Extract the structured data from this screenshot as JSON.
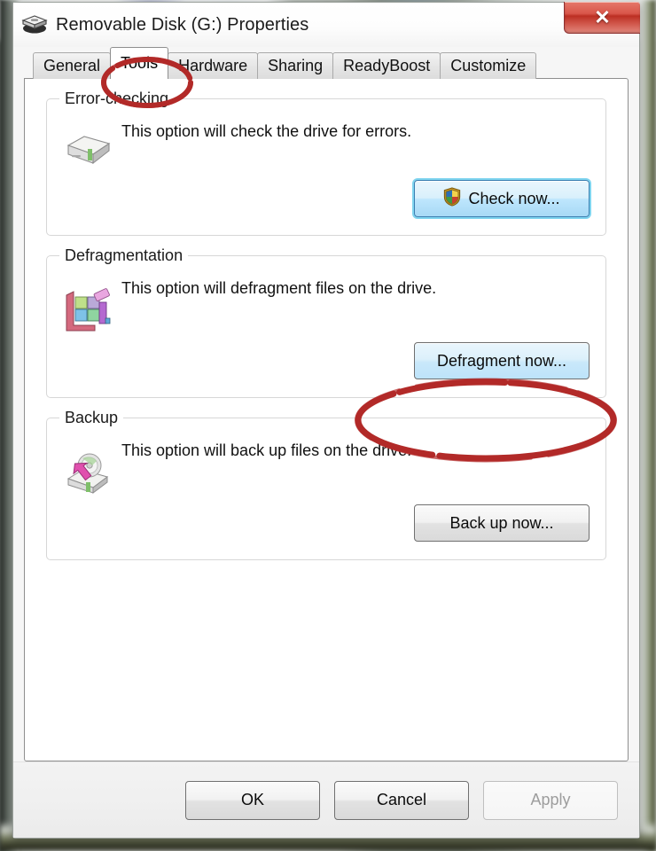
{
  "window": {
    "title": "Removable Disk (G:) Properties",
    "title_icon": "removable-disk-icon",
    "close_label": "✕"
  },
  "tabs": [
    {
      "id": "general",
      "label": "General",
      "active": false
    },
    {
      "id": "tools",
      "label": "Tools",
      "active": true
    },
    {
      "id": "hardware",
      "label": "Hardware",
      "active": false
    },
    {
      "id": "sharing",
      "label": "Sharing",
      "active": false
    },
    {
      "id": "readyboost",
      "label": "ReadyBoost",
      "active": false
    },
    {
      "id": "customize",
      "label": "Customize",
      "active": false
    }
  ],
  "groups": {
    "error_checking": {
      "title": "Error-checking",
      "icon": "hard-drive-icon",
      "description": "This option will check the drive for errors.",
      "button_label": "Check now...",
      "button_icon": "uac-shield-icon",
      "button_state": "focused"
    },
    "defragmentation": {
      "title": "Defragmentation",
      "icon": "defragment-blocks-icon",
      "description": "This option will defragment files on the drive.",
      "button_label": "Defragment now...",
      "button_state": "hover",
      "annotated": true
    },
    "backup": {
      "title": "Backup",
      "icon": "backup-disc-icon",
      "description": "This option will back up files on the drive.",
      "button_label": "Back up now...",
      "button_state": "normal"
    }
  },
  "footer": {
    "ok_label": "OK",
    "cancel_label": "Cancel",
    "apply_label": "Apply",
    "apply_disabled": true
  },
  "annotations": {
    "color": "#b22a28",
    "tools_tab_circled": true,
    "defragment_button_circled": true
  }
}
